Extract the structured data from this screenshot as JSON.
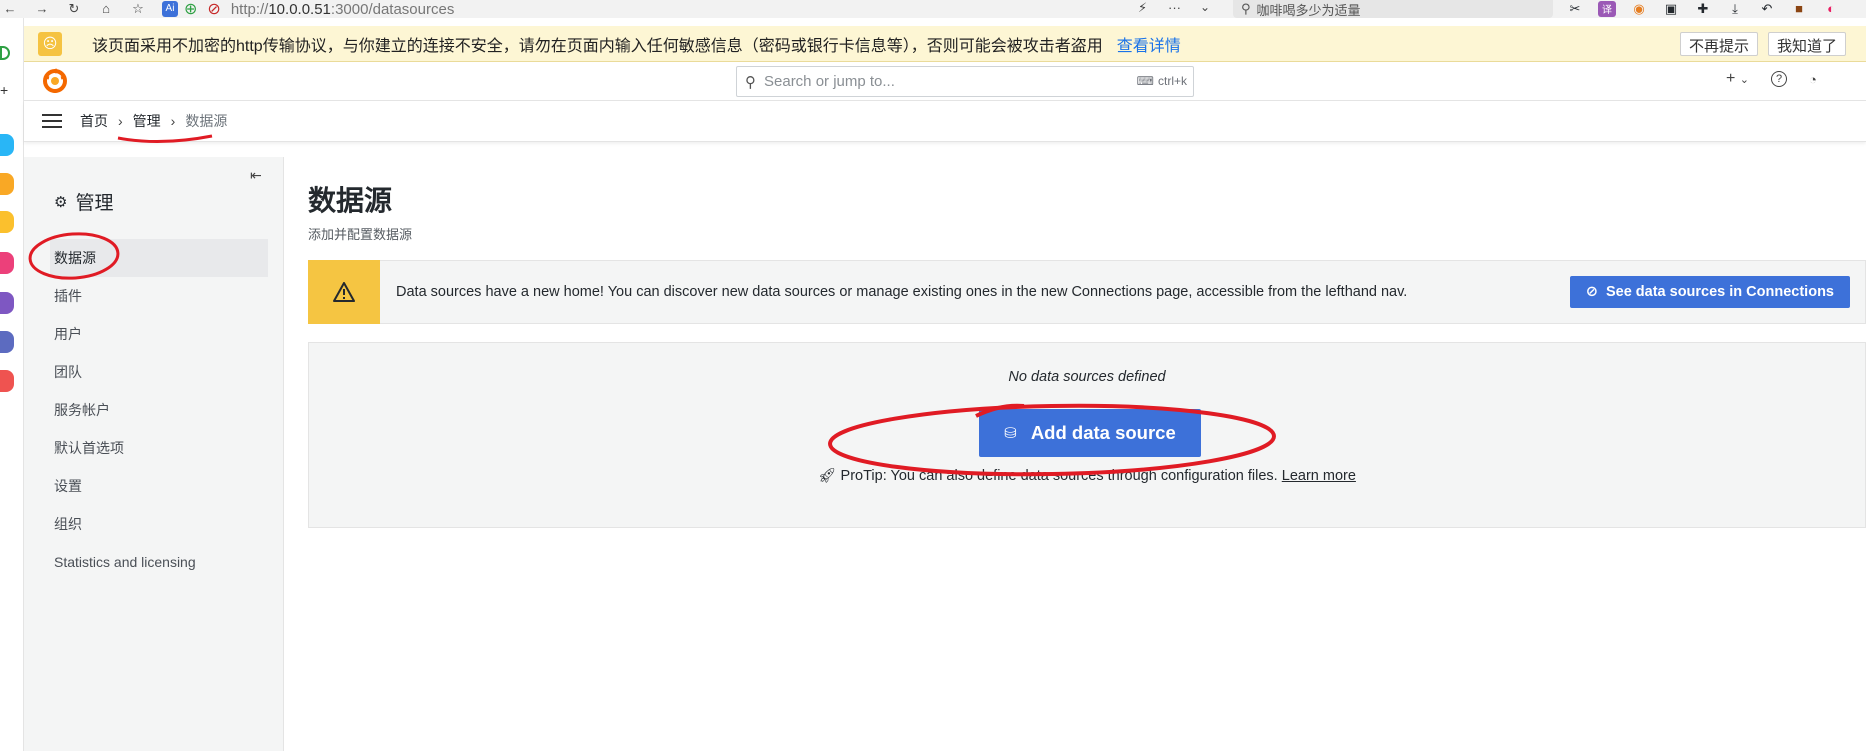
{
  "browser": {
    "url_prefix": "http://",
    "url_host": "10.0.0.51",
    "url_rest": ":3000/datasources",
    "search_text": "咖啡喝多少为适量"
  },
  "warning_bar": {
    "message": "该页面采用不加密的http传输协议，与你建立的连接不安全，请勿在页面内输入任何敏感信息（密码或银行卡信息等），否则可能会被攻击者盗用",
    "details_link": "查看详情",
    "dont_remind": "不再提示",
    "got_it": "我知道了"
  },
  "topnav": {
    "search_placeholder": "Search or jump to...",
    "shortcut": "ctrl+k",
    "add_label": "+"
  },
  "breadcrumb": {
    "home": "首页",
    "admin": "管理",
    "current": "数据源"
  },
  "sidebar": {
    "title": "管理",
    "items": [
      {
        "label": "数据源"
      },
      {
        "label": "插件"
      },
      {
        "label": "用户"
      },
      {
        "label": "团队"
      },
      {
        "label": "服务帐户"
      },
      {
        "label": "默认首选项"
      },
      {
        "label": "设置"
      },
      {
        "label": "组织"
      },
      {
        "label": "Statistics and licensing"
      }
    ]
  },
  "main": {
    "title": "数据源",
    "subtitle": "添加并配置数据源",
    "alert_text": "Data sources have a new home! You can discover new data sources or manage existing ones in the new Connections page, accessible from the lefthand nav.",
    "alert_button": "See data sources in Connections",
    "empty_text": "No data sources defined",
    "add_button": "Add data source",
    "protip_text": "ProTip: You can also define data sources through configuration files.",
    "learn_more": "Learn more"
  },
  "colors": {
    "primary": "#3d71d9",
    "warning": "#f5c542",
    "annotation": "#e01b24"
  }
}
